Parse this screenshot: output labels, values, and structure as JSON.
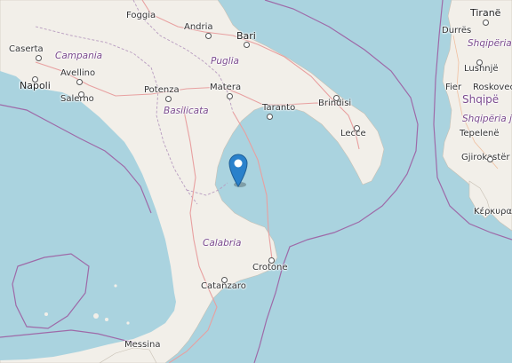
{
  "map": {
    "cities": {
      "foggia": "Foggia",
      "andria": "Andria",
      "bari": "Bari",
      "caserta": "Caserta",
      "napoli": "Napoli",
      "avellino": "Avellino",
      "salerno": "Salerno",
      "potenza": "Potenza",
      "matera": "Matera",
      "taranto": "Taranto",
      "brindisi": "Brindisi",
      "lecce": "Lecce",
      "crotone": "Crotone",
      "catanzaro": "Catanzaro",
      "messina": "Messina",
      "tirane": "Tiranë",
      "durres": "Durrës",
      "lushnje": "Lushnjë",
      "fier": "Fier",
      "roskovec": "Roskovec",
      "tepelene": "Tepelenë",
      "gjirokaster": "Gjirokastër",
      "kerkyra": "Κέρκυρα"
    },
    "regions": {
      "campania": "Campania",
      "puglia": "Puglia",
      "basilicata": "Basilicata",
      "calabria": "Calabria",
      "shqiperia_1": "Shqipëria",
      "shqiperia_2": "Shqipëria ju"
    },
    "country": {
      "albania_partial": "Shqipë"
    },
    "colors": {
      "sea": "#aad3df",
      "land": "#f2efe9",
      "border": "#9e6aa8",
      "road": "#e8a0a0",
      "marker": "#2a81cb"
    },
    "marker_icon": "map-pin-icon"
  }
}
